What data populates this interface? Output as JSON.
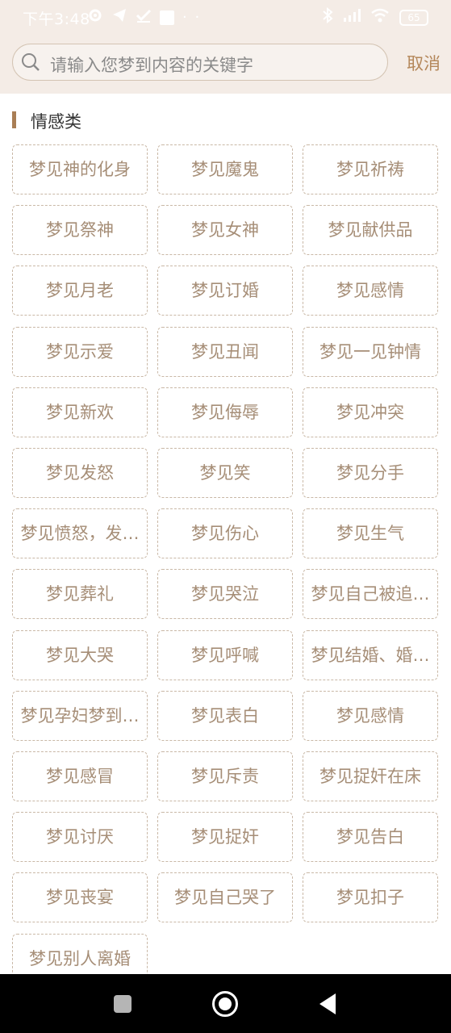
{
  "status_bar": {
    "time": "下午3:48",
    "dots": "· ·",
    "battery": "65"
  },
  "search": {
    "placeholder": "请输入您梦到内容的关键字",
    "cancel_label": "取消"
  },
  "section": {
    "title": "情感类"
  },
  "tags": [
    "梦见神的化身",
    "梦见魔鬼",
    "梦见祈祷",
    "梦见祭神",
    "梦见女神",
    "梦见献供品",
    "梦见月老",
    "梦见订婚",
    "梦见感情",
    "梦见示爱",
    "梦见丑闻",
    "梦见一见钟情",
    "梦见新欢",
    "梦见侮辱",
    "梦见冲突",
    "梦见发怒",
    "梦见笑",
    "梦见分手",
    "梦见愤怒，发…",
    "梦见伤心",
    "梦见生气",
    "梦见葬礼",
    "梦见哭泣",
    "梦见自己被追…",
    "梦见大哭",
    "梦见呼喊",
    "梦见结婚、婚…",
    "梦见孕妇梦到…",
    "梦见表白",
    "梦见感情",
    "梦见感冒",
    "梦见斥责",
    "梦见捉奸在床",
    "梦见讨厌",
    "梦见捉奸",
    "梦见告白",
    "梦见丧宴",
    "梦见自己哭了",
    "梦见扣子",
    "梦见别人离婚"
  ],
  "colors": {
    "header_bg": "#f4ece6",
    "accent": "#b4875a",
    "tag_text": "#a68e77",
    "tag_border": "#c9b8a6"
  },
  "icons": {
    "search": "search-icon",
    "nav_recent": "square-icon",
    "nav_home": "home-circle-icon",
    "nav_back": "back-triangle-icon"
  }
}
